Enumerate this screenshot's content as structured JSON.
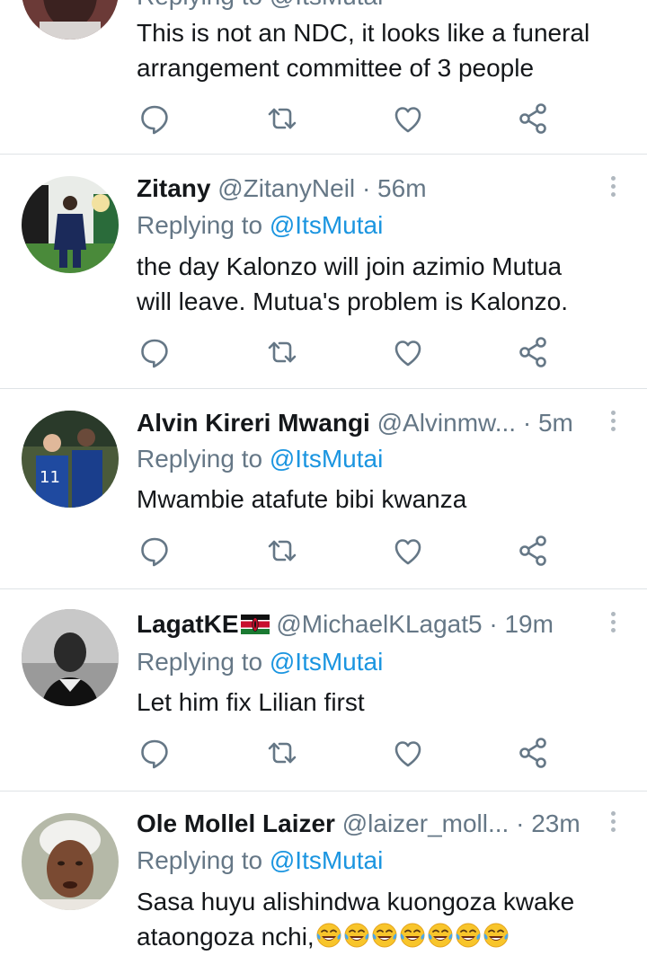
{
  "tweets": [
    {
      "id": "t0",
      "head_partial": "Replying to @ItsMutai",
      "body": [
        "This is not an NDC, it looks like a funeral",
        "arrangement committee of 3 people"
      ]
    },
    {
      "id": "t1",
      "name": "Zitany",
      "handle": "@ZitanyNeil",
      "sep": "·",
      "time": "56m",
      "replying_label": "Replying to",
      "replying_to": "@ItsMutai",
      "body": [
        "the day Kalonzo will join azimio Mutua",
        "will leave. Mutua's problem is Kalonzo."
      ]
    },
    {
      "id": "t2",
      "name": "Alvin Kireri Mwangi",
      "handle": "@Alvinmw...",
      "sep": "·",
      "time": "5m",
      "replying_label": "Replying to",
      "replying_to": "@ItsMutai",
      "body": [
        "Mwambie atafute bibi kwanza"
      ]
    },
    {
      "id": "t3",
      "name": "LagatKE",
      "name_flag": "kenya-flag-emoji",
      "handle": "@MichaelKLagat5",
      "sep": "·",
      "time": "19m",
      "replying_label": "Replying to",
      "replying_to": "@ItsMutai",
      "body": [
        "Let him fix Lilian first"
      ]
    },
    {
      "id": "t4",
      "name": "Ole Mollel Laizer",
      "handle": "@laizer_moll...",
      "sep": "·",
      "time": "23m",
      "replying_label": "Replying to",
      "replying_to": "@ItsMutai",
      "body": [
        "Sasa huyu alishindwa kuongoza kwake",
        "ataongoza nchi,"
      ],
      "body_emoji": "tears-of-joy-emoji",
      "body_emoji_count": 7
    }
  ],
  "icons": {
    "reply": "reply-icon",
    "retweet": "retweet-icon",
    "like": "like-icon",
    "share": "share-icon",
    "more": "more-vertical-icon"
  },
  "colors": {
    "text": "#14171a",
    "muted": "#657786",
    "link": "#1b95e0",
    "icon": "#657786",
    "divider": "#dfe3e6"
  }
}
